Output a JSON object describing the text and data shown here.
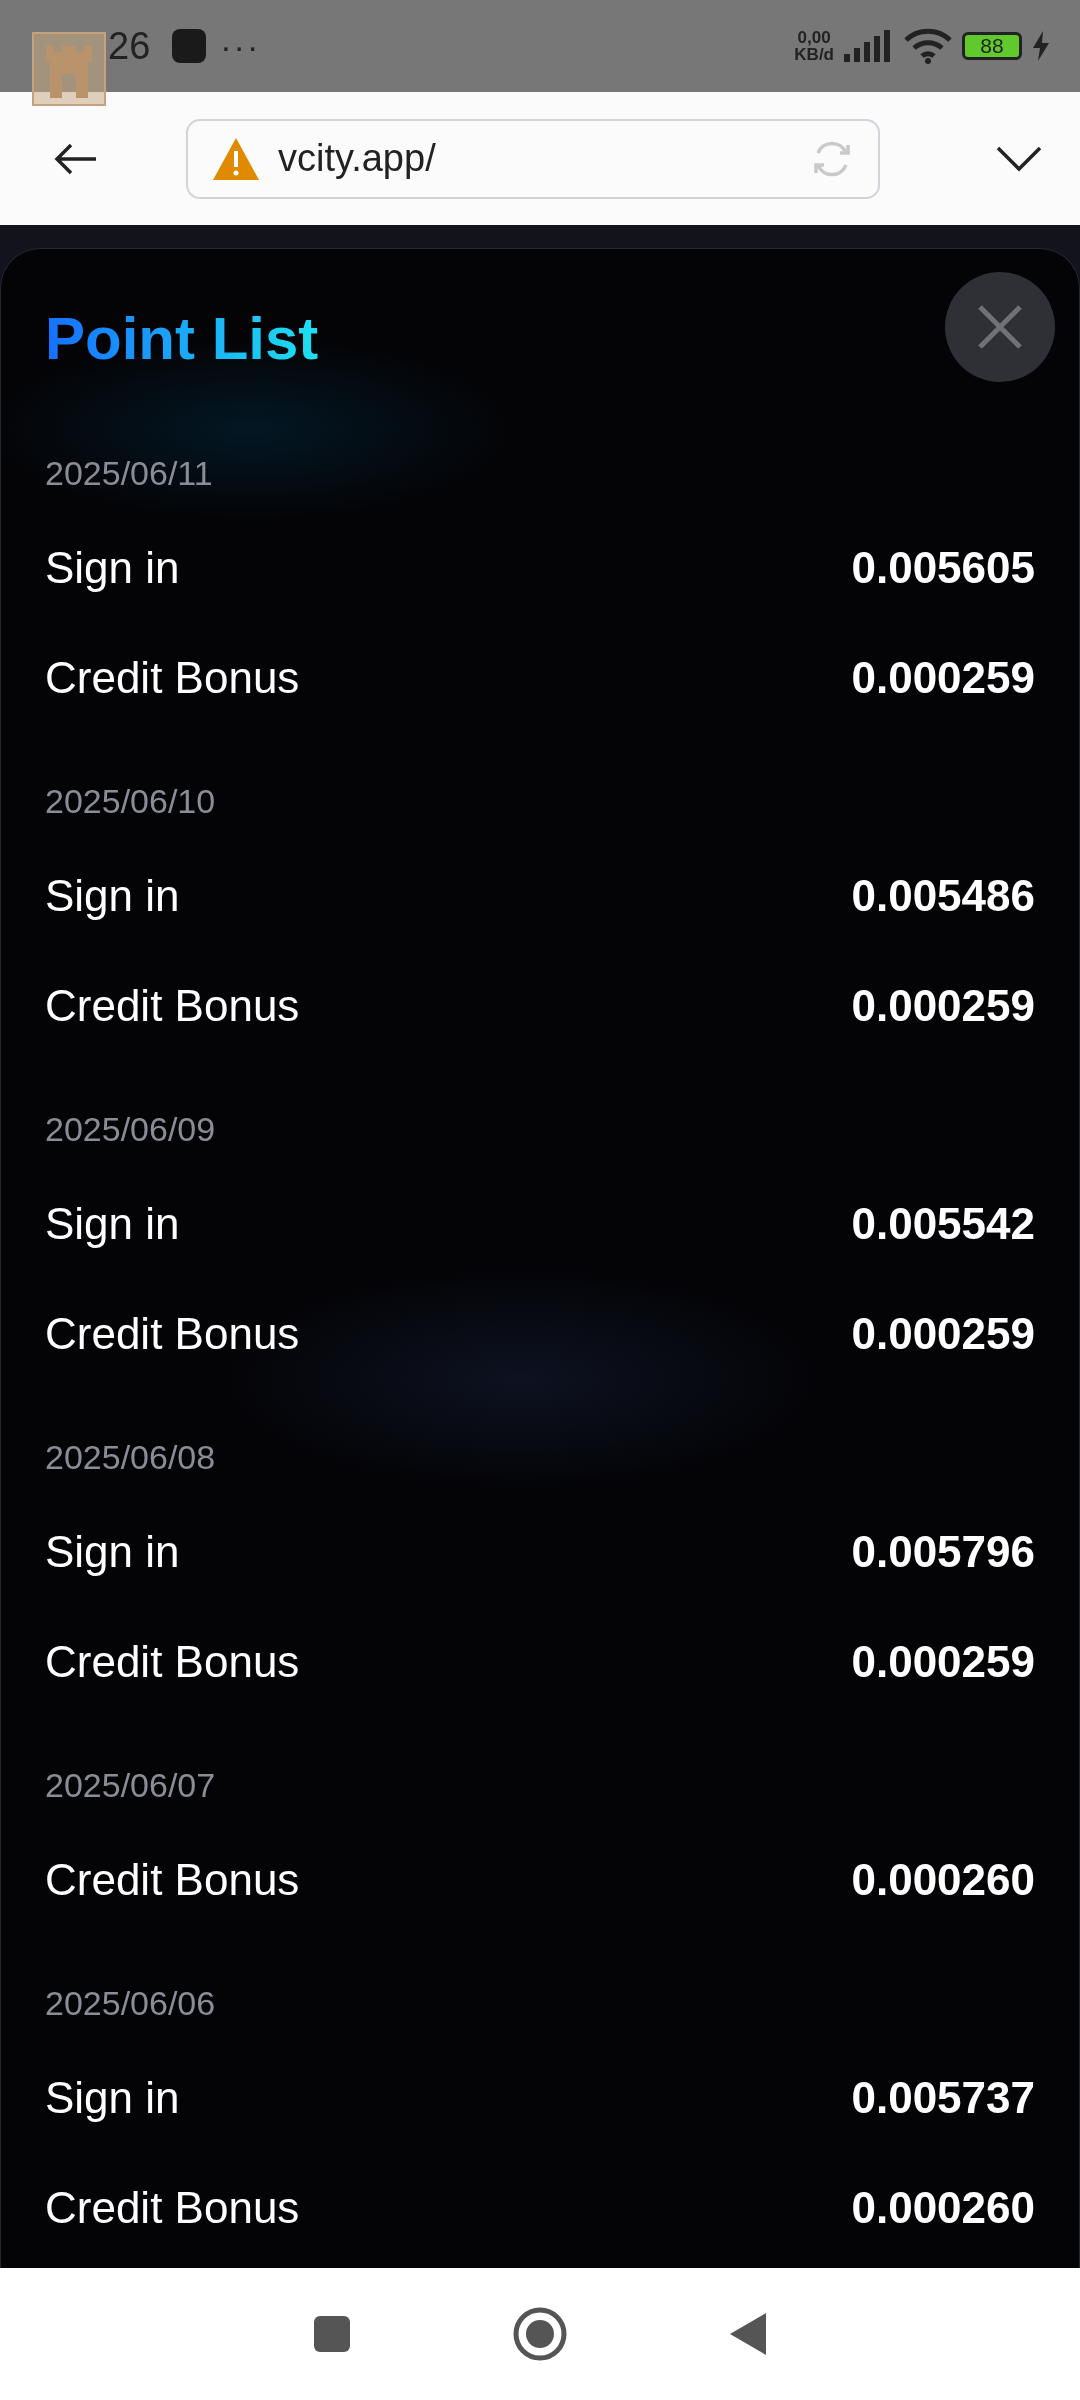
{
  "status_bar": {
    "time": "26",
    "more": "···",
    "speed_value": "0,00",
    "speed_unit": "KB/d",
    "battery": "88"
  },
  "browser": {
    "url": "vcity.app/"
  },
  "panel": {
    "title": "Point List",
    "groups": [
      {
        "date": "2025/06/11",
        "rows": [
          {
            "label": "Sign in",
            "value": "0.005605"
          },
          {
            "label": "Credit Bonus",
            "value": "0.000259"
          }
        ]
      },
      {
        "date": "2025/06/10",
        "rows": [
          {
            "label": "Sign in",
            "value": "0.005486"
          },
          {
            "label": "Credit Bonus",
            "value": "0.000259"
          }
        ]
      },
      {
        "date": "2025/06/09",
        "rows": [
          {
            "label": "Sign in",
            "value": "0.005542"
          },
          {
            "label": "Credit Bonus",
            "value": "0.000259"
          }
        ]
      },
      {
        "date": "2025/06/08",
        "rows": [
          {
            "label": "Sign in",
            "value": "0.005796"
          },
          {
            "label": "Credit Bonus",
            "value": "0.000259"
          }
        ]
      },
      {
        "date": "2025/06/07",
        "rows": [
          {
            "label": "Credit Bonus",
            "value": "0.000260"
          }
        ]
      },
      {
        "date": "2025/06/06",
        "rows": [
          {
            "label": "Sign in",
            "value": "0.005737"
          },
          {
            "label": "Credit Bonus",
            "value": "0.000260"
          }
        ]
      }
    ]
  }
}
